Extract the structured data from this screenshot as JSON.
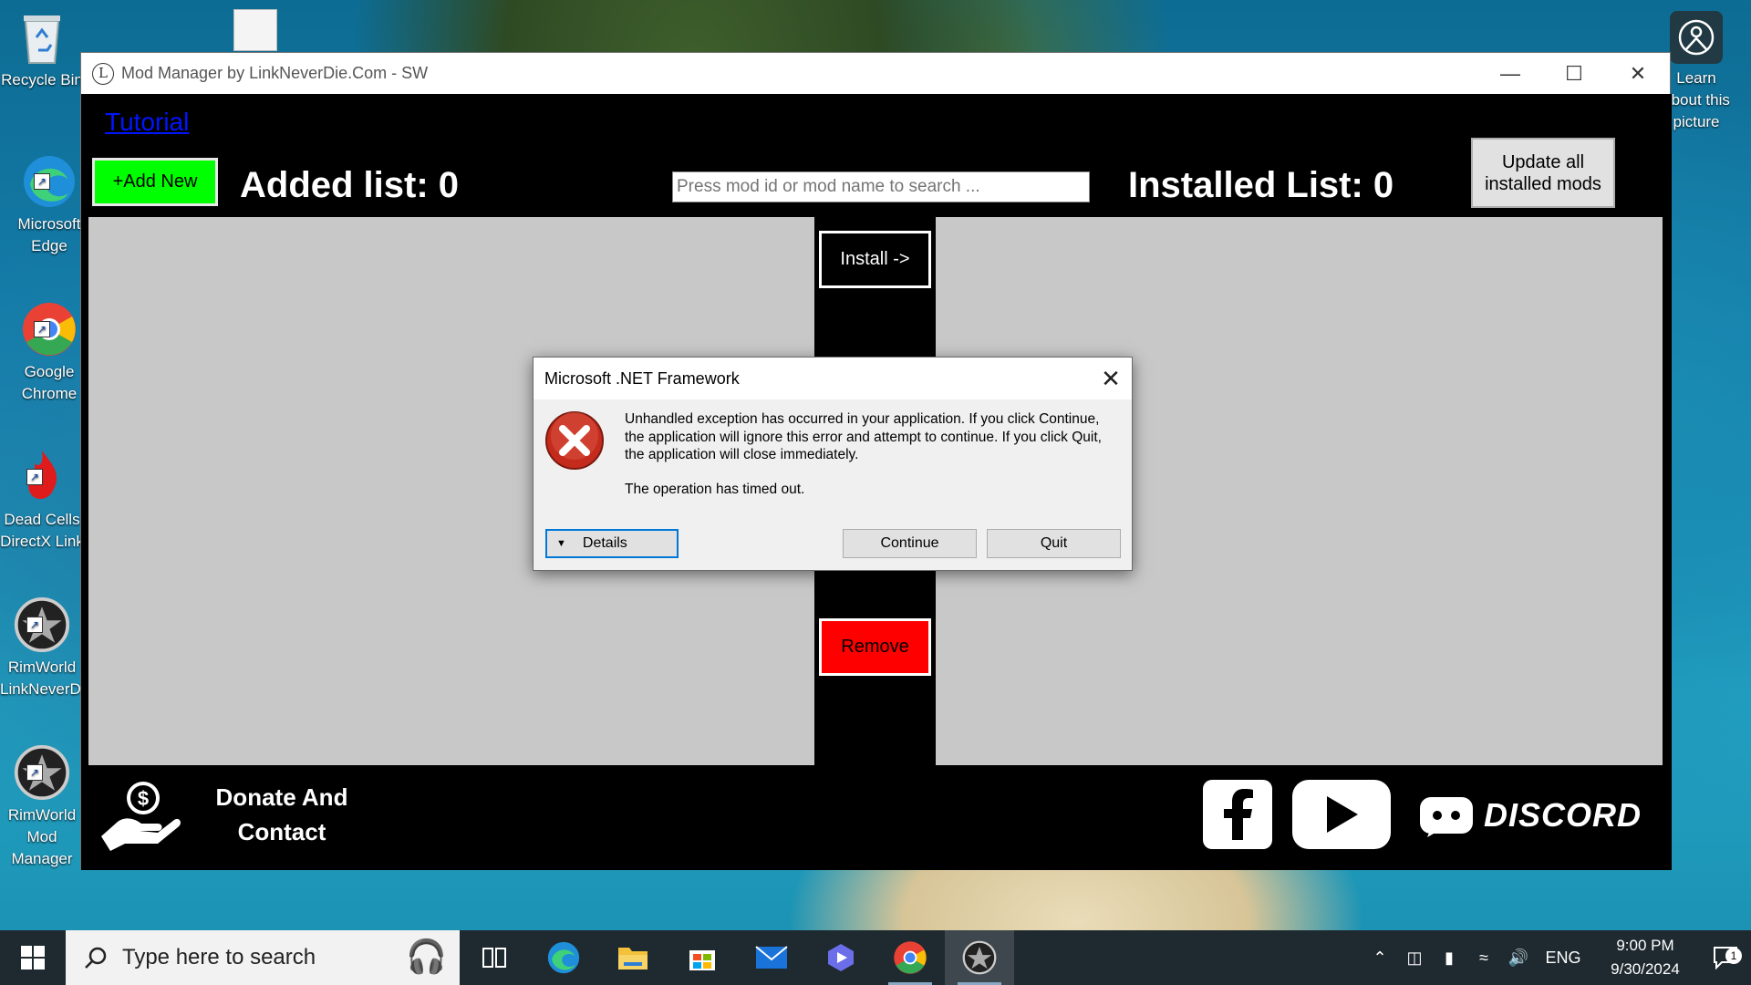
{
  "desktop": {
    "icons": [
      {
        "label": "Recycle Bin"
      },
      {
        "label": "Microsoft Edge"
      },
      {
        "label": "Google Chrome"
      },
      {
        "label": "Dead Cells DirectX Link"
      },
      {
        "label": "RimWorld LinkNeverDie"
      },
      {
        "label": "RimWorld Mod Manager"
      }
    ],
    "about_picture": "Learn about this picture"
  },
  "window": {
    "title": "Mod Manager by LinkNeverDie.Com - SW",
    "tutorial_link": "Tutorial",
    "add_new_label": "+Add New",
    "added_list": "Added list:  0",
    "search_placeholder": "Press mod id or mod name to search ...",
    "installed_list": "Installed List:  0",
    "update_all_label": "Update all installed mods",
    "install_label": "Install ->",
    "remove_label": "Remove",
    "donate_label": "Donate And Contact",
    "discord_label": "DISCORD"
  },
  "dialog": {
    "title": "Microsoft .NET Framework",
    "message": "Unhandled exception has occurred in your application. If you click Continue, the application will ignore this error and attempt to continue. If you click Quit, the application will close immediately.",
    "detail": "The operation has timed out.",
    "details_label": "Details",
    "continue_label": "Continue",
    "quit_label": "Quit"
  },
  "taskbar": {
    "search_placeholder": "Type here to search",
    "language": "ENG",
    "time": "9:00 PM",
    "date": "9/30/2024",
    "notification_count": "1"
  },
  "colors": {
    "add_new": "#00ff00",
    "remove": "#ff0000",
    "tutorial": "#0015ff",
    "focus": "#0078d7"
  }
}
